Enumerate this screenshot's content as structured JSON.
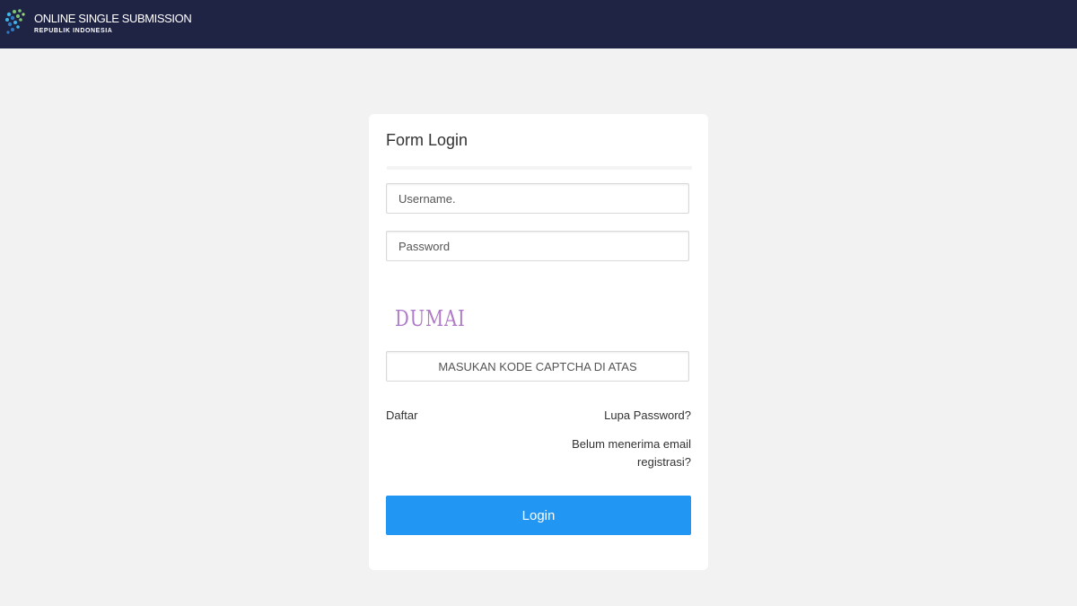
{
  "header": {
    "logo_title": "ONLINE SINGLE SUBMISSION",
    "logo_subtitle": "REPUBLIK INDONESIA"
  },
  "login_form": {
    "title": "Form Login",
    "username_placeholder": "Username.",
    "password_placeholder": "Password",
    "captcha_text": "DUMAI",
    "captcha_placeholder": "MASUKAN KODE CAPTCHA DI ATAS",
    "register_link": "Daftar",
    "forgot_password_link": "Lupa Password?",
    "resend_email_link": "Belum menerima email registrasi?",
    "login_button": "Login"
  },
  "colors": {
    "header_bg": "#1f2344",
    "page_bg": "#f2f2f2",
    "button_bg": "#2196f3",
    "captcha": "#b07bc6"
  }
}
